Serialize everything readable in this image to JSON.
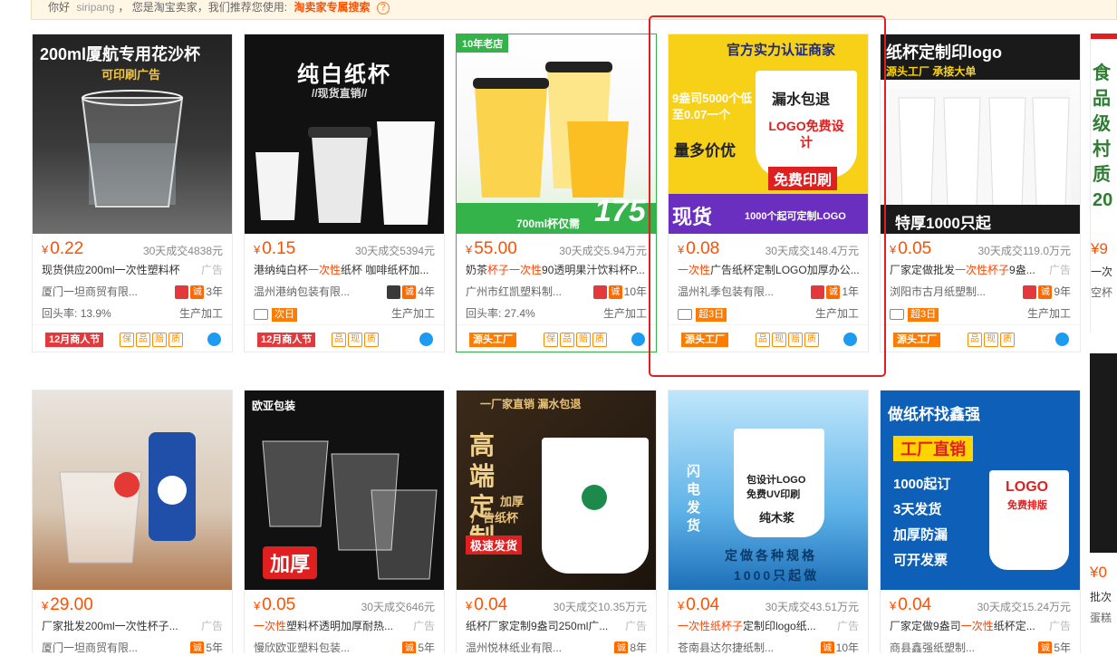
{
  "topbar": {
    "greeting": "你好",
    "user": "siripang",
    "sep": "，",
    "role": "您是淘宝卖家，我们推荐您使用:",
    "search_link": "淘卖家专属搜索",
    "help": "?"
  },
  "row1": [
    {
      "img_line1": "200ml厦航专用花沙杯",
      "img_line2": "可印刷广告",
      "price": "0.22",
      "sold": "30天成交4838元",
      "title_pre": "现货供应200ml一次性塑料杯",
      "title_hl": "",
      "title_post": "",
      "ad": "广告",
      "shop": "厦门一坦商贸有限...",
      "years": "3年",
      "repeat": "回头率:",
      "repeat_val": "13.9%",
      "proc": "生产加工",
      "foot": "12月商人节",
      "foot_icons": [
        "保",
        "品",
        "赔",
        "质"
      ]
    },
    {
      "img_line1": "纯白纸杯",
      "img_line2": "//现货直销//",
      "price": "0.15",
      "sold": "30天成交5394元",
      "title_pre": "港纳纯白杯",
      "title_hl": "一次性",
      "title_post": "纸杯 咖啡纸杯加...",
      "ad": "",
      "shop": "温州港纳包装有限...",
      "years": "4年",
      "repeat": "",
      "repeat_val": "",
      "proc": "生产加工",
      "tag": "次日",
      "foot": "12月商人节",
      "foot_icons": [
        "品",
        "现",
        "质"
      ]
    },
    {
      "img_line1": "10年老店",
      "img_line2": "700ml杯仅需",
      "img_price": "175",
      "price": "55.00",
      "sold": "30天成交5.94万元",
      "title_pre": "奶茶",
      "title_hl": "杯子一次性",
      "title_post": "90透明果汁饮料杯P...",
      "ad": "",
      "shop": "广州市红凯塑料制...",
      "years": "10年",
      "repeat": "回头率:",
      "repeat_val": "27.4%",
      "proc": "生产加工",
      "foot": "源头工厂",
      "foot_icons": [
        "保",
        "品",
        "赔",
        "质"
      ]
    },
    {
      "img_line1": "官方实力认证商家",
      "img_line2": "9盎司5000个低至0.07一个",
      "img_line3": "漏水包退",
      "img_line4": "LOGO免费设计",
      "img_line5": "量多价优",
      "img_line6": "免费印刷",
      "img_line7": "现货",
      "img_line8": "1000个起可定制LOGO",
      "price": "0.08",
      "sold": "30天成交148.4万元",
      "title_pre": "",
      "title_hl": "一次性",
      "title_post": "广告纸杯定制LOGO加厚办公...",
      "ad": "",
      "shop": "温州礼季包装有限...",
      "years": "1年",
      "repeat": "",
      "repeat_val": "",
      "proc": "生产加工",
      "tag": "超3日",
      "foot": "源头工厂",
      "foot_icons": [
        "品",
        "现",
        "赔",
        "质"
      ]
    },
    {
      "img_line1": "纸杯定制印logo",
      "img_line2": "源头工厂 承接大单",
      "img_line3": "特厚1000只起",
      "price": "0.05",
      "sold": "30天成交119.0万元",
      "title_pre": "厂家定做批发",
      "title_hl": "一次性杯子",
      "title_post": "9盎...",
      "ad": "广告",
      "shop": "浏阳市古月纸塑制...",
      "years": "9年",
      "repeat": "",
      "repeat_val": "",
      "proc": "生产加工",
      "tag": "超3日",
      "foot": "源头工厂",
      "foot_icons": [
        "品",
        "现",
        "质"
      ]
    }
  ],
  "row2": [
    {
      "price": "29.00",
      "sold": "",
      "title_pre": "厂家批发200ml一次性杯子...",
      "title_hl": "",
      "title_post": "",
      "ad": "广告",
      "shop": "厦门一坦商贸有限...",
      "years": "5年"
    },
    {
      "img_line1": "欧亚包装",
      "img_line2": "加厚",
      "price": "0.05",
      "sold": "30天成交646元",
      "title_pre": "",
      "title_hl": "一次性",
      "title_post": "塑料杯透明加厚耐热...",
      "ad": "广告",
      "shop": "慢欣欧亚塑料包装...",
      "years": "5年"
    },
    {
      "img_line1": "一厂家直销 漏水包退",
      "img_line2": "高端定制",
      "img_line3": "加厚",
      "img_line4": "广告纸杯",
      "img_line5": "极速发货",
      "price": "0.04",
      "sold": "30天成交10.35万元",
      "title_pre": "纸杯厂家定制9盎司250ml广...",
      "title_hl": "",
      "title_post": "",
      "ad": "广告",
      "shop": "温州悦林纸业有限...",
      "years": "8年"
    },
    {
      "img_line1": "包设计LOGO",
      "img_line2": "免费UV印刷",
      "img_line3": "纯木浆",
      "img_line4": "闪电发货",
      "img_line5": "定做各种规格",
      "img_line6": "1000只起做",
      "price": "0.04",
      "sold": "30天成交43.51万元",
      "title_pre": "",
      "title_hl": "一次性纸杯子",
      "title_post": "定制印logo纸...",
      "ad": "广告",
      "shop": "苍南县达尔捷纸制...",
      "years": "10年"
    },
    {
      "img_line1": "做纸杯找鑫强",
      "img_line2": "工厂直销",
      "img_line3": "1000起订",
      "img_line4": "3天发货",
      "img_line5": "加厚防漏",
      "img_line6": "可开发票",
      "img_line7": "LOGO",
      "img_line8": "免费排版",
      "price": "0.04",
      "sold": "30天成交15.24万元",
      "title_pre": "厂家定做9盎司",
      "title_hl": "一次性",
      "title_post": "纸杯定...",
      "ad": "广告",
      "shop": "商县鑫强纸塑制...",
      "years": "5年"
    }
  ],
  "partial": {
    "r1_price": "¥9",
    "r1_t1": "一次",
    "r1_t2": "空杯",
    "r2_price": "¥0",
    "r2_t1": "批次",
    "r2_t2": "蛋糕",
    "img_text": "食品级村质20"
  },
  "currency": "¥",
  "colors": {
    "accent": "#ff5000",
    "highlight": "#e02020"
  }
}
